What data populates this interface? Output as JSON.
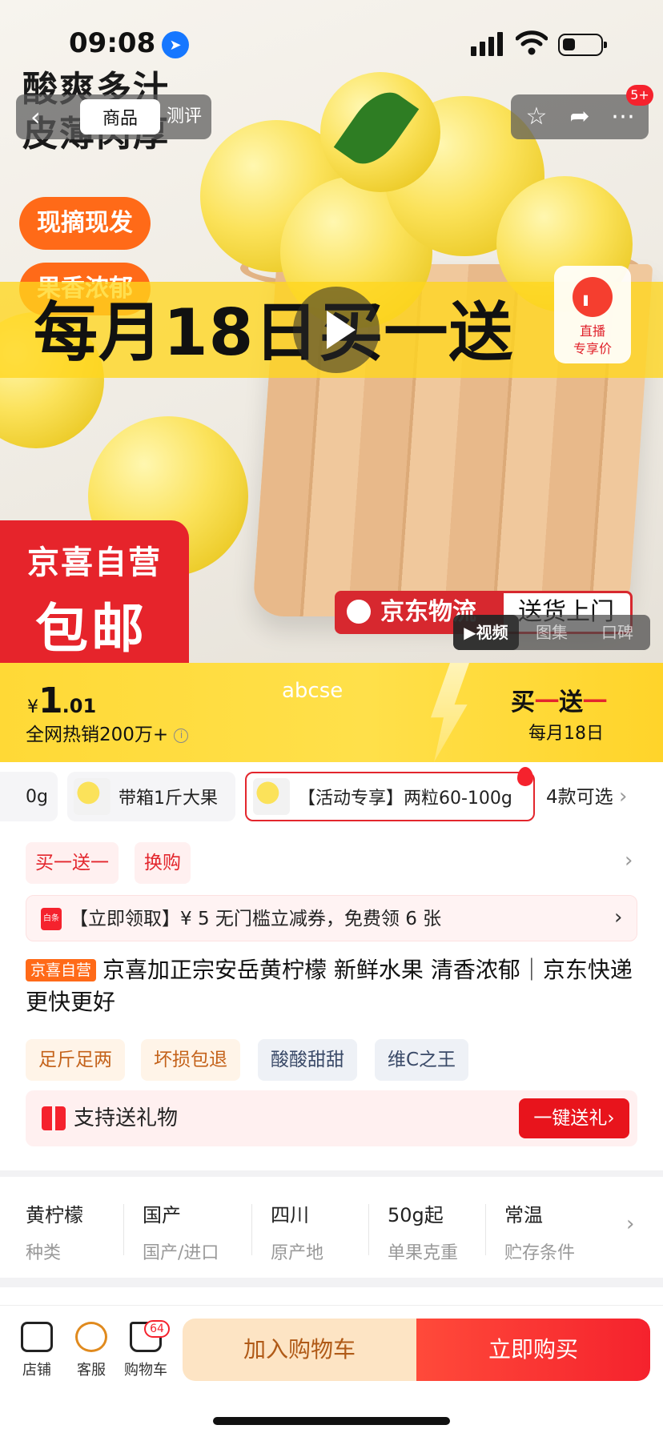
{
  "status": {
    "time": "09:08"
  },
  "hero": {
    "promo_lines": [
      "酸爽多汁",
      "皮薄肉厚"
    ],
    "badges": [
      "现摘现发",
      "果香浓郁"
    ],
    "band_text": "每月18日买一送",
    "live": {
      "line1": "直播",
      "line2": "专享价"
    },
    "store_badge": {
      "line1": "京喜自营",
      "line2": "包邮"
    },
    "logistics": {
      "brand": "京东物流",
      "service": "送货上门"
    },
    "media_tabs": [
      "▶视频",
      "图集",
      "口碑"
    ]
  },
  "nav": {
    "back_icon": "chevron-left-icon",
    "tabs": [
      "商品",
      "测评"
    ],
    "more_badge": "5+"
  },
  "price": {
    "currency": "¥",
    "integer": "1",
    "decimal": ".01",
    "sales": "全网热销200万+",
    "watermark": "abcse"
  },
  "promo": {
    "title_a": "买",
    "title_b": "一",
    "title_c": "送",
    "title_d": "一",
    "date": "每月18日"
  },
  "sku": {
    "items": [
      "0g",
      "带箱1斤大果",
      "【活动专享】两粒60-100g"
    ],
    "more": "4款可选"
  },
  "tags": [
    "买一送一",
    "换购"
  ],
  "coupon": {
    "icon_text": "白条",
    "text": "【立即领取】¥ 5 无门槛立减券，免费领 6 张"
  },
  "product": {
    "store_tag": "京喜自营",
    "title": "京喜加正宗安岳黄柠檬 新鲜水果 清香浓郁｜京东快递 更快更好"
  },
  "features": [
    "足斤足两",
    "坏损包退",
    "酸酸甜甜",
    "维C之王"
  ],
  "gift": {
    "text": "支持送礼物",
    "button": "一键送礼›"
  },
  "attributes": [
    {
      "value": "黄柠檬",
      "key": "种类"
    },
    {
      "value": "国产",
      "key": "国产/进口"
    },
    {
      "value": "四川",
      "key": "原产地"
    },
    {
      "value": "50g起",
      "key": "单果克重"
    },
    {
      "value": "常温",
      "key": "贮存条件"
    }
  ],
  "bottom": {
    "store": "店铺",
    "service": "客服",
    "cart": "购物车",
    "cart_count": "64",
    "add_cart": "加入购物车",
    "buy_now": "立即购买"
  },
  "colors": {
    "accent": "#e3262d",
    "promo_yellow": "#ffd936",
    "orange": "#ff6a18"
  }
}
